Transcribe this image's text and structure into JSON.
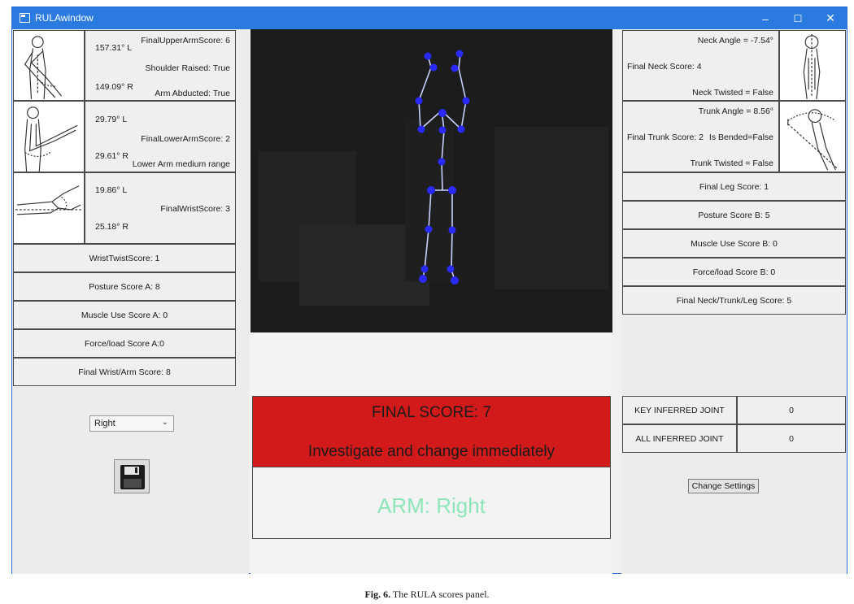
{
  "window": {
    "title": "RULAwindow",
    "minimize": "–",
    "maximize": "☐",
    "close": "✕"
  },
  "left": {
    "upper_arm": {
      "angle_l": "157.31° L",
      "angle_r": "149.09° R",
      "score": "FinalUpperArmScore: 6",
      "shoulder": "Shoulder Raised: True",
      "abducted": "Arm Abducted: True"
    },
    "lower_arm": {
      "angle_l": "29.79° L",
      "angle_r": "29.61° R",
      "score": "FinalLowerArmScore: 2",
      "range": "Lower Arm medium range"
    },
    "wrist": {
      "angle_l": "19.86° L",
      "angle_r": "25.18° R",
      "score": "FinalWristScore: 3"
    },
    "rows": [
      "WristTwistScore: 1",
      "Posture Score A: 8",
      "Muscle Use Score A: 0",
      "Force/load Score A:0",
      "Final Wrist/Arm Score: 8"
    ],
    "dropdown_value": "Right"
  },
  "right": {
    "neck": {
      "angle": "Neck Angle = -7.54°",
      "score": "Final Neck Score: 4",
      "twisted": "Neck Twisted = False"
    },
    "trunk": {
      "angle": "Trunk Angle = 8.56°",
      "score": "Final Trunk Score: 2",
      "bended": "Is Bended=False",
      "twisted": "Trunk Twisted = False"
    },
    "rows": [
      "Final Leg Score: 1",
      "Posture Score B: 5",
      "Muscle Use Score B: 0",
      "Force/load Score B: 0",
      "Final Neck/Trunk/Leg Score: 5"
    ],
    "inferred": [
      {
        "label": "KEY INFERRED JOINT",
        "value": "0"
      },
      {
        "label": "ALL INFERRED JOINT",
        "value": "0"
      }
    ],
    "change_settings": "Change Settings"
  },
  "center": {
    "final_score": "FINAL SCORE: 7",
    "message": "Investigate and change immediately",
    "arm": "ARM: Right"
  },
  "colors": {
    "final_bg": "#d21a1a",
    "arm_text": "#8ee5b8",
    "titlebar": "#2b7ae0",
    "skeleton_joint": "#2a2aff"
  },
  "caption": {
    "label": "Fig. 6.",
    "text": " The RULA scores panel."
  }
}
